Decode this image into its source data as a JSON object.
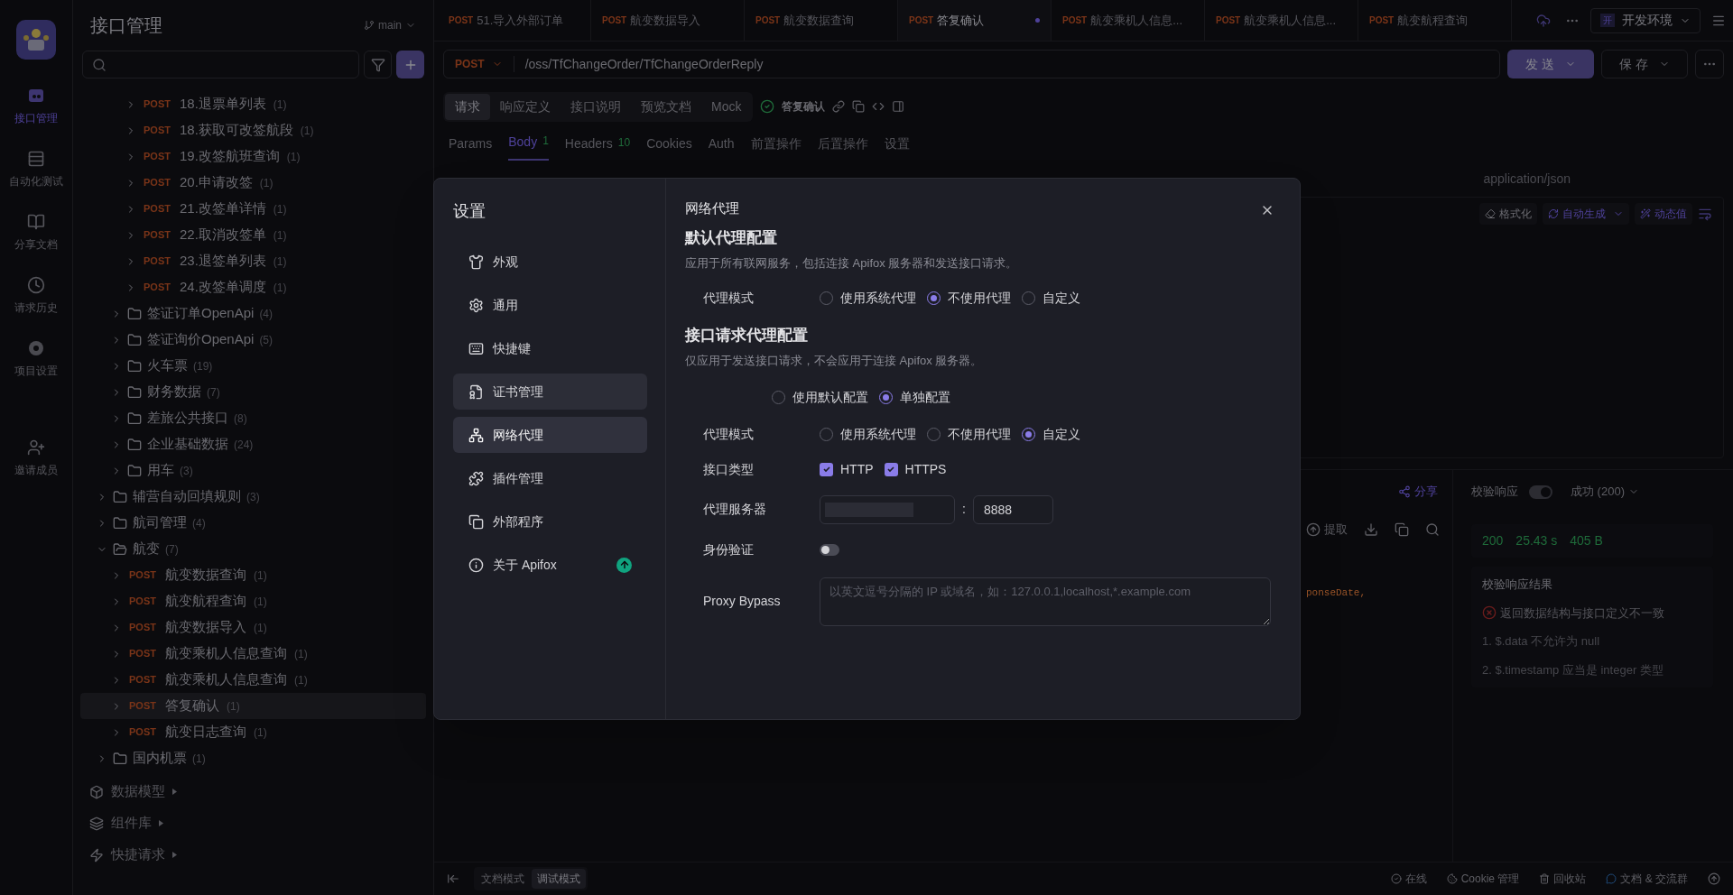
{
  "rail": {
    "items": [
      {
        "label": "接口管理",
        "selected": true
      },
      {
        "label": "自动化测试",
        "selected": false
      },
      {
        "label": "分享文档",
        "selected": false
      },
      {
        "label": "请求历史",
        "selected": false
      },
      {
        "label": "项目设置",
        "selected": false
      },
      {
        "label": "邀请成员",
        "selected": false
      }
    ]
  },
  "tree": {
    "title": "接口管理",
    "branch": "main",
    "nodes": [
      {
        "children": [
          {
            "children": [
              {
                "kind": "api",
                "method": "POST",
                "label": "18.退票单列表",
                "count": "(1)",
                "selected": false
              },
              {
                "kind": "api",
                "method": "POST",
                "label": "18.获取可改签航段",
                "count": "(1)",
                "selected": false
              },
              {
                "kind": "api",
                "method": "POST",
                "label": "19.改签航班查询",
                "count": "(1)",
                "selected": false
              },
              {
                "kind": "api",
                "method": "POST",
                "label": "20.申请改签",
                "count": "(1)",
                "selected": false
              },
              {
                "kind": "api",
                "method": "POST",
                "label": "21.改签单详情",
                "count": "(1)",
                "selected": false
              },
              {
                "kind": "api",
                "method": "POST",
                "label": "22.取消改签单",
                "count": "(1)",
                "selected": false
              },
              {
                "kind": "api",
                "method": "POST",
                "label": "23.退签单列表",
                "count": "(1)",
                "selected": false
              },
              {
                "kind": "api",
                "method": "POST",
                "label": "24.改签单调度",
                "count": "(1)",
                "selected": false
              }
            ]
          },
          {
            "kind": "folder",
            "label": "签证订单OpenApi",
            "count": "(4)",
            "expanded": false
          },
          {
            "kind": "folder",
            "label": "签证询价OpenApi",
            "count": "(5)",
            "expanded": false
          },
          {
            "kind": "folder",
            "label": "火车票",
            "count": "(19)",
            "expanded": false
          },
          {
            "kind": "folder",
            "label": "财务数据",
            "count": "(7)",
            "expanded": false
          },
          {
            "kind": "folder",
            "label": "差旅公共接口",
            "count": "(8)",
            "expanded": false
          },
          {
            "kind": "folder",
            "label": "企业基础数据",
            "count": "(24)",
            "expanded": false
          },
          {
            "kind": "folder",
            "label": "用车",
            "count": "(3)",
            "expanded": false
          }
        ]
      },
      {
        "kind": "folder",
        "label": "辅营自动回填规则",
        "count": "(3)",
        "expanded": false
      },
      {
        "kind": "folder",
        "label": "航司管理",
        "count": "(4)",
        "expanded": false
      },
      {
        "kind": "folder",
        "label": "航变",
        "count": "(7)",
        "expanded": true,
        "children": [
          {
            "kind": "api",
            "method": "POST",
            "label": "航变数据查询",
            "count": "(1)",
            "selected": false
          },
          {
            "kind": "api",
            "method": "POST",
            "label": "航变航程查询",
            "count": "(1)",
            "selected": false
          },
          {
            "kind": "api",
            "method": "POST",
            "label": "航变数据导入",
            "count": "(1)",
            "selected": false
          },
          {
            "kind": "api",
            "method": "POST",
            "label": "航变乘机人信息查询",
            "count": "(1)",
            "selected": false
          },
          {
            "kind": "api",
            "method": "POST",
            "label": "航变乘机人信息查询",
            "count": "(1)",
            "selected": false
          },
          {
            "kind": "api",
            "method": "POST",
            "label": "答复确认",
            "count": "(1)",
            "selected": true
          },
          {
            "kind": "api",
            "method": "POST",
            "label": "航变日志查询",
            "count": "(1)",
            "selected": false
          }
        ]
      },
      {
        "kind": "folder",
        "label": "国内机票",
        "count": "(1)",
        "expanded": false
      }
    ],
    "footer": [
      {
        "label": "数据模型"
      },
      {
        "label": "组件库"
      },
      {
        "label": "快捷请求"
      }
    ]
  },
  "tabs": [
    {
      "method": "POST",
      "label": "51.导入外部订单",
      "selected": false,
      "unsaved": false
    },
    {
      "method": "POST",
      "label": "航变数据导入",
      "selected": false,
      "unsaved": false
    },
    {
      "method": "POST",
      "label": "航变数据查询",
      "selected": false,
      "unsaved": false
    },
    {
      "method": "POST",
      "label": "答复确认",
      "selected": true,
      "unsaved": true
    },
    {
      "method": "POST",
      "label": "航变乘机人信息...",
      "selected": false,
      "unsaved": false
    },
    {
      "method": "POST",
      "label": "航变乘机人信息...",
      "selected": false,
      "unsaved": false
    },
    {
      "method": "POST",
      "label": "航变航程查询",
      "selected": false,
      "unsaved": false
    }
  ],
  "environment": {
    "badge": "开",
    "label": "开发环境"
  },
  "request": {
    "method": "POST",
    "path": "/oss/TfChangeOrder/TfChangeOrderReply",
    "send": "发 送",
    "save": "保 存"
  },
  "mode_tabs": [
    {
      "label": "请求",
      "selected": true
    },
    {
      "label": "响应定义",
      "selected": false
    },
    {
      "label": "接口说明",
      "selected": false
    },
    {
      "label": "预览文档",
      "selected": false
    },
    {
      "label": "Mock",
      "selected": false
    }
  ],
  "api_name": "答复确认",
  "param_tabs": [
    {
      "label": "Params",
      "selected": false
    },
    {
      "label": "Body",
      "count": "1",
      "selected": true
    },
    {
      "label": "Headers",
      "count": "10",
      "selected": false
    },
    {
      "label": "Cookies",
      "selected": false
    },
    {
      "label": "Auth",
      "selected": false
    },
    {
      "label": "前置操作",
      "selected": false
    },
    {
      "label": "后置操作",
      "selected": false
    },
    {
      "label": "设置",
      "selected": false
    }
  ],
  "body": {
    "content_type": "application/json",
    "tools": [
      {
        "kind": "format",
        "label": "格式化"
      },
      {
        "kind": "generate",
        "label": "自动生成"
      },
      {
        "kind": "dynamic",
        "label": "动态值"
      }
    ]
  },
  "response": {
    "share": "分享",
    "extract": "提取",
    "code_fragment": "ponseDate,",
    "validate_label": "校验响应",
    "validate_on": true,
    "status_select": "成功 (200)",
    "stats": [
      "200",
      "25.43 s",
      "405 B"
    ],
    "result_title": "校验响应结果",
    "error": "返回数据结构与接口定义不一致",
    "issues": [
      "1. $.data 不允许为 null",
      "2. $.timestamp 应当是 integer 类型"
    ]
  },
  "bottom": {
    "modes": [
      {
        "label": "文档模式",
        "selected": false
      },
      {
        "label": "调试模式",
        "selected": true
      }
    ],
    "links": [
      {
        "label": "在线"
      },
      {
        "label": "Cookie 管理"
      },
      {
        "label": "回收站"
      },
      {
        "label": "文档 & 交流群"
      }
    ]
  },
  "settings": {
    "title": "设置",
    "nav": [
      {
        "label": "外观",
        "selected": false
      },
      {
        "label": "通用",
        "selected": false
      },
      {
        "label": "快捷键",
        "selected": false
      },
      {
        "label": "证书管理",
        "selected": false,
        "hovered": true
      },
      {
        "label": "网络代理",
        "selected": true
      },
      {
        "label": "插件管理",
        "selected": false
      },
      {
        "label": "外部程序",
        "selected": false
      },
      {
        "label": "关于 Apifox",
        "selected": false,
        "update": true
      }
    ],
    "heading": "网络代理",
    "default_section": {
      "title": "默认代理配置",
      "description": "应用于所有联网服务，包括连接 Apifox 服务器和发送接口请求。",
      "mode": {
        "label": "代理模式",
        "options": [
          {
            "label": "使用系统代理",
            "selected": false
          },
          {
            "label": "不使用代理",
            "selected": true
          },
          {
            "label": "自定义",
            "selected": false
          }
        ]
      }
    },
    "request_section": {
      "title": "接口请求代理配置",
      "description": "仅应用于发送接口请求，不会应用于连接 Apifox 服务器。",
      "source": [
        {
          "label": "使用默认配置",
          "selected": false
        },
        {
          "label": "单独配置",
          "selected": true
        }
      ],
      "mode": {
        "label": "代理模式",
        "options": [
          {
            "label": "使用系统代理",
            "selected": false
          },
          {
            "label": "不使用代理",
            "selected": false
          },
          {
            "label": "自定义",
            "selected": true
          }
        ]
      },
      "types": {
        "label": "接口类型",
        "options": [
          {
            "label": "HTTP",
            "checked": true
          },
          {
            "label": "HTTPS",
            "checked": true
          }
        ]
      },
      "server": {
        "label": "代理服务器",
        "separator": ":",
        "port": "8888"
      },
      "auth": {
        "label": "身份验证",
        "on": false
      },
      "bypass": {
        "label": "Proxy Bypass",
        "placeholder": "以英文逗号分隔的 IP 或域名，如：127.0.0.1,localhost,*.example.com"
      }
    }
  }
}
